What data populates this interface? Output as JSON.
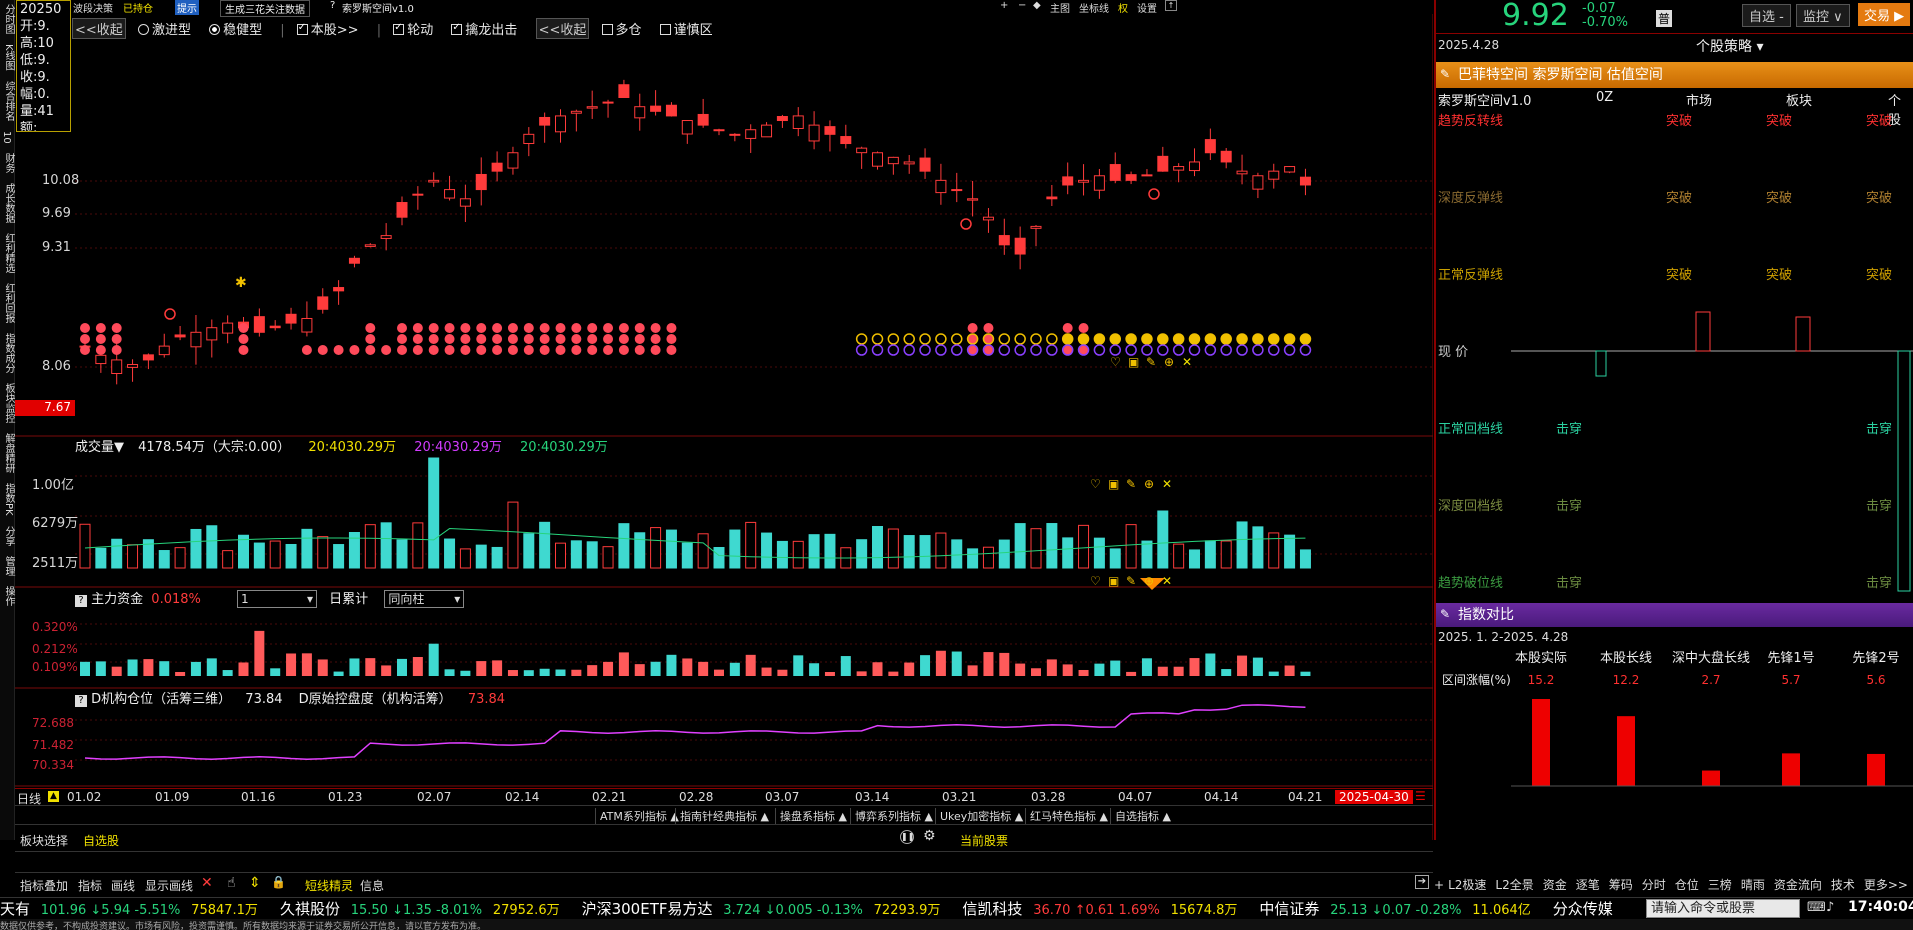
{
  "sidebar": [
    "分时图",
    "K线图",
    "综合排名",
    "10",
    "财务",
    "成长数据",
    "红利精选",
    "红利回报",
    "指数成分",
    "板块监控",
    "解盘精研",
    "指数PK",
    "分享",
    "管理",
    "操作"
  ],
  "top": {
    "strategy_label": "波段决策",
    "strategy_value": "已持仓",
    "hint_badge": "提示",
    "tabs": [
      "生成三花关注数据",
      "索罗斯空间v1.0"
    ],
    "right_items": [
      "主图",
      "坐标线",
      "权",
      "设置"
    ]
  },
  "options": {
    "collapse_left": "<<收起",
    "radio1": "激进型",
    "radio2": "稳健型",
    "chk_benshen": "本股>>",
    "chk_lundong": "轮动",
    "chk_qinlong": "擒龙出击",
    "collapse_right": "<<收起",
    "chk_duocang": "多仓",
    "chk_jinshen": "谨慎区"
  },
  "infobox": [
    "20250",
    "开:9.",
    "高:10",
    "低:9.",
    "收:9.",
    "幅:0.",
    "量:41",
    "额:"
  ],
  "price_axis": [
    "10.08",
    "9.69",
    "9.31",
    "8.06"
  ],
  "current_price_tag": "7.67",
  "volume": {
    "title": "成交量▼",
    "value": "4178.54万（大宗:0.00）",
    "ma1": "20:4030.29万",
    "ma2": "20:4030.29万",
    "ma3": "20:4030.29万",
    "axis": [
      "1.00亿",
      "6279万",
      "2511万"
    ]
  },
  "capital": {
    "title": "主力资金",
    "value": "0.018%",
    "select1": "1",
    "label2": "日累计",
    "select2": "同向柱",
    "axis": [
      "0.320%",
      "0.212%",
      "0.109%"
    ]
  },
  "institution": {
    "title": "D机构仓位（活筹三维）",
    "value": "73.84",
    "title2": "D原始控盘度（机构活筹）",
    "value2": "73.84",
    "axis": [
      "72.688",
      "71.482",
      "70.334"
    ]
  },
  "dates": {
    "label": "日线",
    "ticks": [
      "01.02",
      "01.09",
      "01.16",
      "01.23",
      "02.07",
      "02.14",
      "02.21",
      "02.28",
      "03.07",
      "03.14",
      "03.21",
      "03.28",
      "04.07",
      "04.14",
      "04.21"
    ],
    "current": "2025-04-30"
  },
  "indicator_tabs": [
    "ATM系列指标 ▲",
    "指南针经典指标 ▲",
    "操盘系指标 ▲",
    "博弈系列指标 ▲",
    "Ukey加密指标 ▲",
    "红马特色指标 ▲",
    "自选指标 ▲"
  ],
  "block_bar": {
    "select": "板块选择",
    "watch": "自选股",
    "current": "当前股票"
  },
  "toolbar": [
    "指标叠加",
    "指标",
    "画线",
    "显示画线"
  ],
  "toolbar2": [
    "短线精灵",
    "信息"
  ],
  "l2_tabs": [
    "L2极速",
    "L2全景",
    "资金",
    "逐笔",
    "筹码",
    "分时",
    "仓位",
    "三榜",
    "晴雨",
    "资金流向",
    "技术",
    "更多>>"
  ],
  "right": {
    "price": "9.92",
    "change": "-0.07",
    "pct": "-0.70%",
    "badge": "普",
    "btn1": "自选 -",
    "btn2": "监控 ∨",
    "btn3": "交易 ▶",
    "date": "2025.4.28",
    "strategy_dd": "个股策略 ▾",
    "panel1_title": "巴菲特空间 索罗斯空间 估值空间",
    "col_headers": [
      "索罗斯空间v1.0",
      "0Z",
      "市场",
      "板块",
      "个股"
    ],
    "rows": [
      {
        "label": "趋势反转线",
        "vals": [
          "突破",
          "突破",
          "突破"
        ]
      },
      {
        "label": "深度反弹线",
        "vals": [
          "突破",
          "突破",
          "突破"
        ]
      },
      {
        "label": "正常反弹线",
        "vals": [
          "突破",
          "突破",
          "突破"
        ]
      },
      {
        "label": "现    价",
        "vals": []
      },
      {
        "label": "正常回档线",
        "vals": [
          "击穿",
          "击穿"
        ]
      },
      {
        "label": "深度回档线",
        "vals": [
          "击穿",
          "击穿"
        ]
      },
      {
        "label": "趋势破位线",
        "vals": [
          "击穿",
          "击穿"
        ]
      }
    ],
    "panel2_title": "指数对比",
    "range": "2025. 1. 2-2025. 4.28",
    "cmp_headers": [
      "本股实际",
      "本股长线",
      "深中大盘长线",
      "先锋1号",
      "先锋2号"
    ],
    "cmp_label": "区间涨幅(%)",
    "cmp_values": [
      15.2,
      12.2,
      2.7,
      5.7,
      5.6
    ],
    "cmp_value_labels": [
      "15.2",
      "12.2",
      "2.7",
      "5.7",
      "5.6"
    ]
  },
  "ticker": [
    {
      "name": "天有",
      "price": "101.96",
      "chg": "↓5.94",
      "pct": "-5.51%",
      "amt": "75847.1万",
      "up": false
    },
    {
      "name": "久祺股份",
      "price": "15.50",
      "chg": "↓1.35",
      "pct": "-8.01%",
      "amt": "27952.6万",
      "up": false
    },
    {
      "name": "沪深300ETF易方达",
      "price": "3.724",
      "chg": "↓0.005",
      "pct": "-0.13%",
      "amt": "72293.9万",
      "up": false
    },
    {
      "name": "信凯科技",
      "price": "36.70",
      "chg": "↑0.61",
      "pct": "1.69%",
      "amt": "15674.8万",
      "up": true
    },
    {
      "name": "中信证券",
      "price": "25.13",
      "chg": "↓0.07",
      "pct": "-0.28%",
      "amt": "11.064亿",
      "up": false
    },
    {
      "name": "分众传媒",
      "price": "",
      "chg": "",
      "pct": "",
      "amt": "",
      "up": false
    }
  ],
  "command_placeholder": "请输入命令或股票",
  "clock": "17:40:04",
  "bottom_text": "数据仅供参考，不构成投资建议。市场有风险，投资需谨慎。所有数据均来源于证券交易所公开信息，请以官方发布为准。"
}
